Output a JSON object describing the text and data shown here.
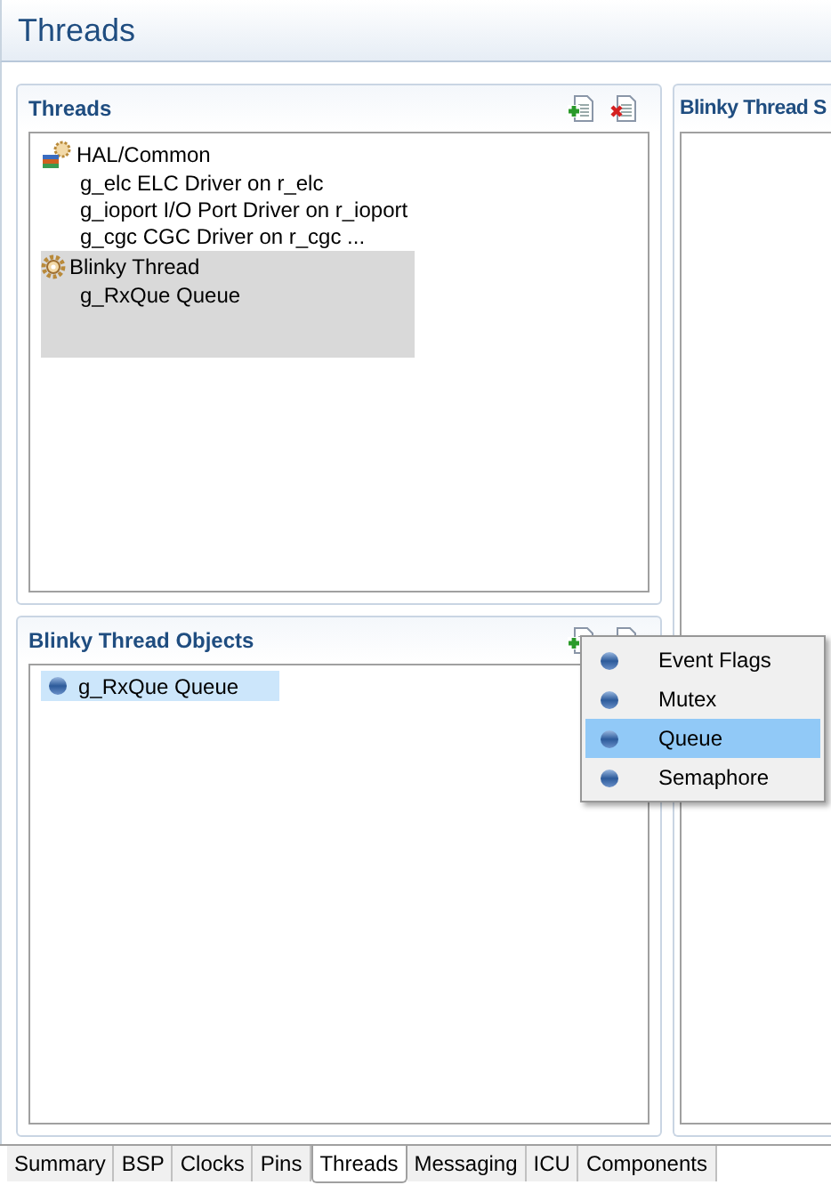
{
  "page_title": "Threads",
  "threads_panel": {
    "title": "Threads",
    "tree": [
      {
        "label": "HAL/Common",
        "kind": "group",
        "selected": false,
        "children": [
          {
            "label": "g_elc ELC Driver on r_elc"
          },
          {
            "label": "g_ioport I/O Port Driver on r_ioport"
          },
          {
            "label": "g_cgc CGC Driver on r_cgc ..."
          }
        ]
      },
      {
        "label": "Blinky Thread",
        "kind": "thread",
        "selected": true,
        "children": [
          {
            "label": "g_RxQue Queue"
          }
        ]
      }
    ]
  },
  "objects_panel": {
    "title": "Blinky Thread Objects",
    "items": [
      {
        "label": "g_RxQue Queue",
        "selected": true
      }
    ]
  },
  "settings_panel": {
    "title": "Blinky Thread S"
  },
  "new_object_menu": [
    {
      "label": "Event Flags",
      "selected": false
    },
    {
      "label": "Mutex",
      "selected": false
    },
    {
      "label": "Queue",
      "selected": true
    },
    {
      "label": "Semaphore",
      "selected": false
    }
  ],
  "tabs": [
    {
      "label": "Summary",
      "selected": false
    },
    {
      "label": "BSP",
      "selected": false
    },
    {
      "label": "Clocks",
      "selected": false
    },
    {
      "label": "Pins",
      "selected": false
    },
    {
      "label": "Threads",
      "selected": true
    },
    {
      "label": "Messaging",
      "selected": false
    },
    {
      "label": "ICU",
      "selected": false
    },
    {
      "label": "Components",
      "selected": false
    }
  ]
}
